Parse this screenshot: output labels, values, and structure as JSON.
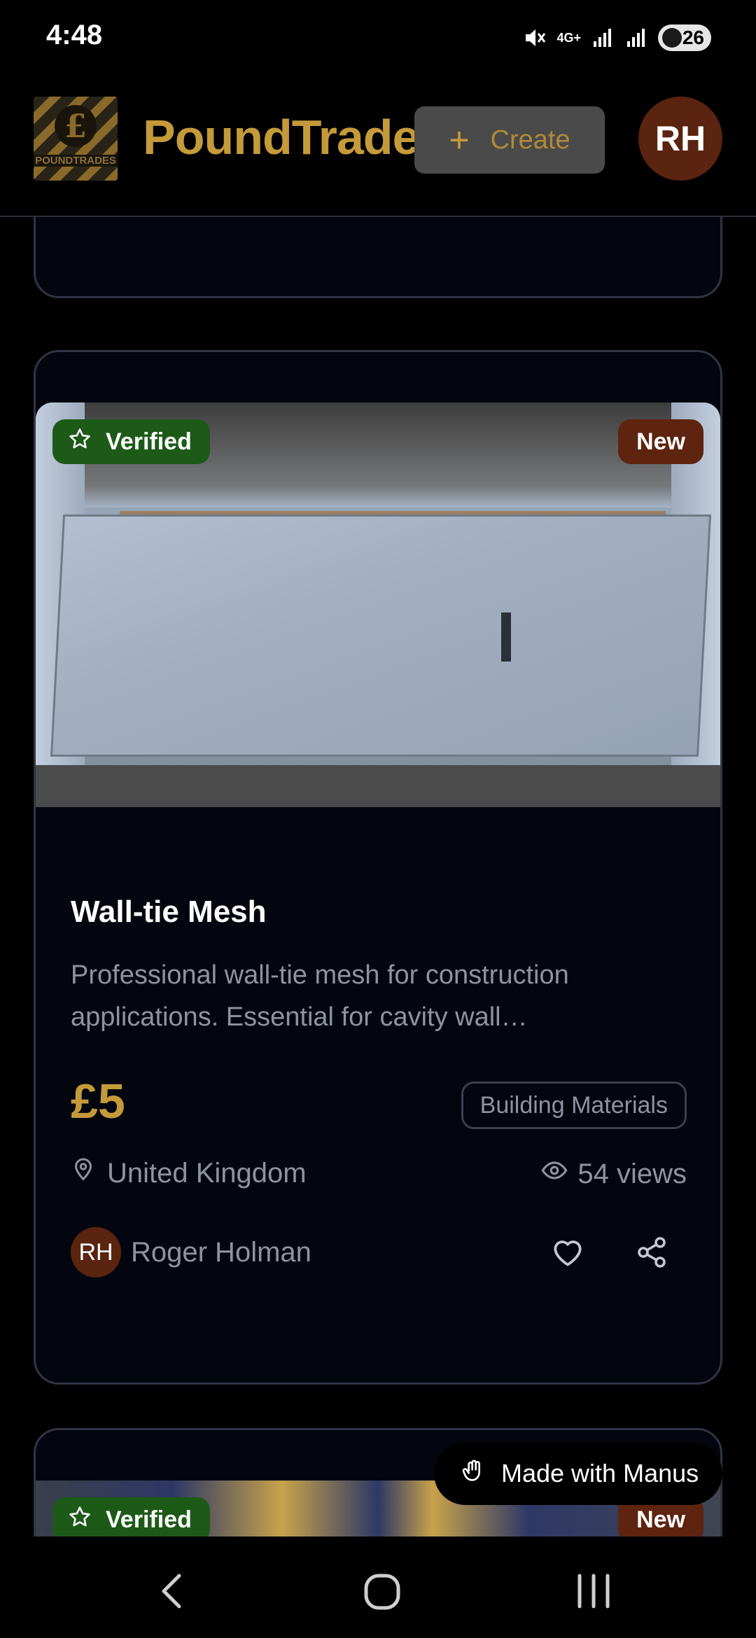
{
  "status_bar": {
    "time": "4:48",
    "network": "4G+",
    "battery": "26"
  },
  "header": {
    "logo_text": "POUNDTRADES",
    "logo_symbol": "£",
    "brand_name": "PoundTrade",
    "create_label": "Create",
    "user_initials": "RH"
  },
  "listing": {
    "verified_label": "Verified",
    "new_label": "New",
    "title": "Wall-tie Mesh",
    "description": "Professional wall-tie mesh for construction applications. Essential for cavity wall…",
    "price": "£5",
    "category": "Building Materials",
    "location": "United Kingdom",
    "views": "54 views",
    "seller_initials": "RH",
    "seller_name": "Roger Holman"
  },
  "next_listing": {
    "verified_label": "Verified",
    "new_label": "New"
  },
  "overlay": {
    "made_with": "Made with Manus"
  },
  "colors": {
    "accent_gold": "#c49a3a",
    "verified_green": "#1d5a18",
    "new_brown": "#5e2410",
    "avatar_brown": "#5a2410",
    "card_bg": "#04060f",
    "card_border": "#2f3545"
  }
}
